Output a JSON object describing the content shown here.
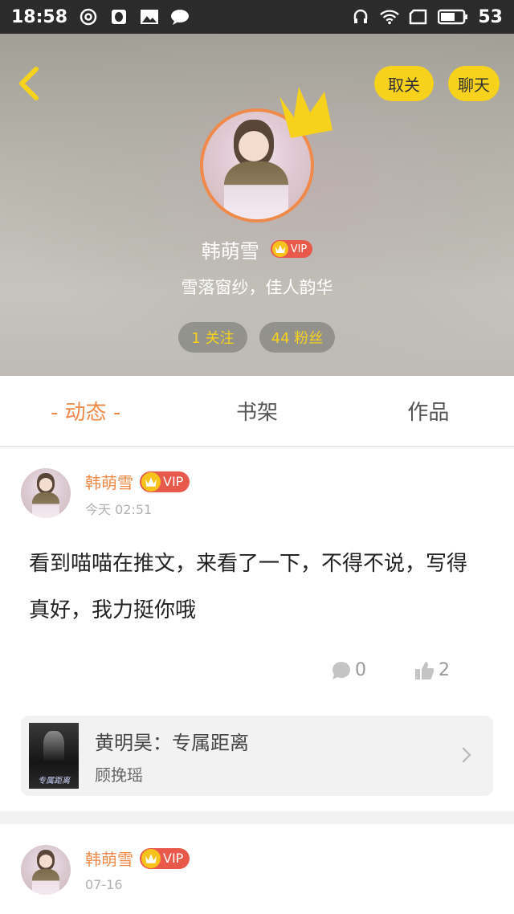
{
  "status_bar": {
    "time": "18:58",
    "battery": "53",
    "icons": [
      "netease-music-icon",
      "qq-icon",
      "gallery-icon",
      "message-icon",
      "headset-icon",
      "wifi-icon",
      "screen-icon",
      "battery-icon"
    ]
  },
  "header": {
    "back_icon": "chevron-left-icon",
    "unfollow_label": "取关",
    "chat_label": "聊天",
    "user_name": "韩萌雪",
    "vip_label": "VIP",
    "signature": "雪落窗纱，佳人韵华",
    "following": "1 关注",
    "fans": "44 粉丝",
    "accent_color": "#f7d21c",
    "avatar_ring_color": "#f08a4b"
  },
  "tabs": [
    {
      "label": "- 动态 -",
      "active": true
    },
    {
      "label": "书架",
      "active": false
    },
    {
      "label": "作品",
      "active": false
    }
  ],
  "posts": [
    {
      "author": "韩萌雪",
      "vip_label": "VIP",
      "time": "今天 02:51",
      "content": "看到喵喵在推文，来看了一下，不得不说，写得真好，我力挺你哦",
      "comments": "0",
      "likes": "2",
      "book": {
        "cover_text": "专属距离",
        "title": "黄明昊：专属距离",
        "author": "顾挽瑶"
      }
    },
    {
      "author": "韩萌雪",
      "vip_label": "VIP",
      "time": "07-16"
    }
  ],
  "colors": {
    "accent_orange": "#ef8a4a",
    "vip_red": "#e9594b"
  }
}
